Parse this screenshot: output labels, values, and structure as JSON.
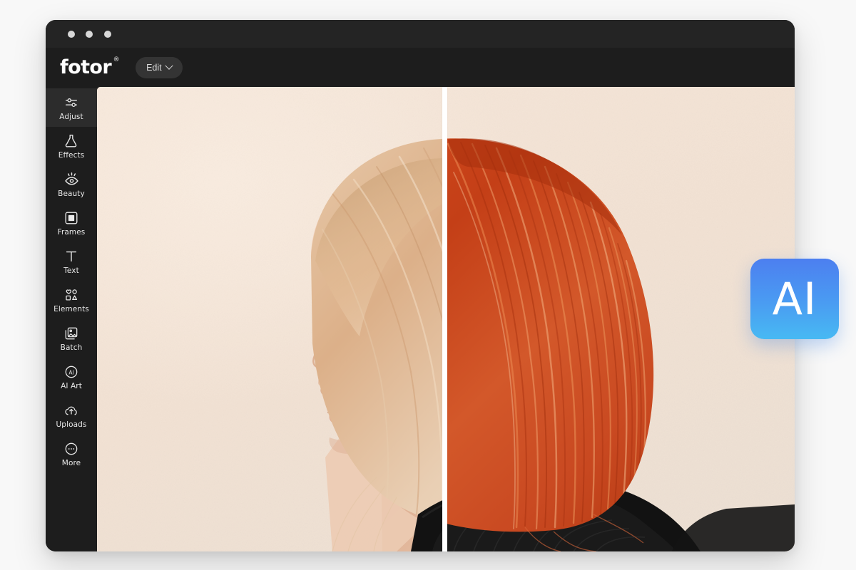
{
  "window": {
    "traffic_lights": [
      "close",
      "minimize",
      "maximize"
    ]
  },
  "header": {
    "logo_text": "fotor",
    "logo_registered_mark": "®",
    "edit_button_label": "Edit",
    "edit_chevron_icon": "chevron-down-icon"
  },
  "sidebar": {
    "items": [
      {
        "label": "Adjust",
        "icon": "sliders-icon",
        "active": true
      },
      {
        "label": "Effects",
        "icon": "flask-icon",
        "active": false
      },
      {
        "label": "Beauty",
        "icon": "eye-icon",
        "active": false
      },
      {
        "label": "Frames",
        "icon": "frame-icon",
        "active": false
      },
      {
        "label": "Text",
        "icon": "text-t-icon",
        "active": false
      },
      {
        "label": "Elements",
        "icon": "shapes-icon",
        "active": false
      },
      {
        "label": "Batch",
        "icon": "batch-images-icon",
        "active": false
      },
      {
        "label": "AI Art",
        "icon": "ai-circle-icon",
        "active": false
      },
      {
        "label": "Uploads",
        "icon": "cloud-upload-icon",
        "active": false
      },
      {
        "label": "More",
        "icon": "more-dots-icon",
        "active": false
      }
    ]
  },
  "canvas": {
    "photo_description": "Side profile portrait of a woman with eyes closed, split before/after hair color comparison",
    "split_divider": "vertical-white-line",
    "left_half": "blonde hair (original)",
    "right_half": "red hair (AI recolored)"
  },
  "ai_badge": {
    "label": "AI",
    "color_top": "#4c7ff0",
    "color_bottom": "#47b9f3"
  },
  "colors": {
    "window_background": "#202020",
    "sidebar_background": "#1d1d1d",
    "header_background": "#1d1d1d",
    "page_background": "#f8f8f8",
    "photo_paper": "#f2e2d4",
    "hair_blonde": "#ddb090",
    "hair_red": "#c94520",
    "turtleneck": "#111111"
  }
}
